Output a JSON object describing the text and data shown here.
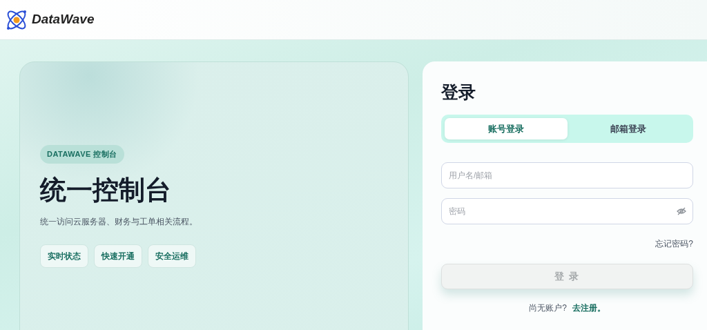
{
  "header": {
    "logo_text": "DataWave"
  },
  "hero": {
    "badge": "DATAWAVE 控制台",
    "title": "统一控制台",
    "subtitle": "统一访问云服务器、财务与工单相关流程。",
    "tags": [
      "实时状态",
      "快速开通",
      "安全运维"
    ]
  },
  "login": {
    "title": "登录",
    "tabs": [
      {
        "label": "账号登录",
        "selected": true
      },
      {
        "label": "邮箱登录",
        "selected": false
      }
    ],
    "username": {
      "placeholder": "用户名/邮箱"
    },
    "password": {
      "placeholder": "密码"
    },
    "forgot": "忘记密码?",
    "submit": {
      "label": "登 录",
      "disabled": true
    },
    "signup_prompt": "尚无账户?",
    "signup_link": "去注册。"
  }
}
